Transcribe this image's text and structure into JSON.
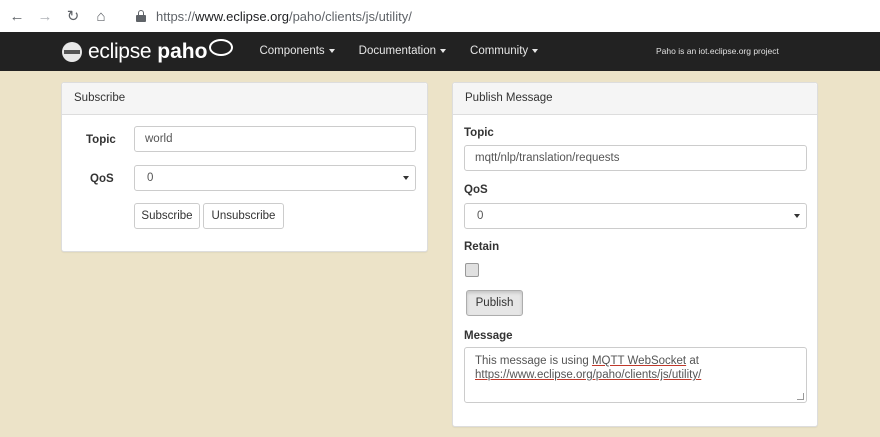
{
  "browser": {
    "url_scheme": "https://",
    "url_host": "www.eclipse.org",
    "url_path": "/paho/clients/js/utility/"
  },
  "navbar": {
    "logo_eclipse": "eclipse",
    "logo_paho": "paho",
    "menu": [
      {
        "label": "Components"
      },
      {
        "label": "Documentation"
      },
      {
        "label": "Community"
      }
    ],
    "tagline": "Paho is an iot.eclipse.org project",
    "background": "#222222"
  },
  "subscribe": {
    "heading": "Subscribe",
    "topic_label": "Topic",
    "topic_value": "world",
    "qos_label": "QoS",
    "qos_value": "0",
    "subscribe_button": "Subscribe",
    "unsubscribe_button": "Unsubscribe"
  },
  "publish": {
    "heading": "Publish Message",
    "topic_label": "Topic",
    "topic_value": "mqtt/nlp/translation/requests",
    "qos_label": "QoS",
    "qos_value": "0",
    "retain_label": "Retain",
    "retain_checked": false,
    "publish_button": "Publish",
    "message_label": "Message",
    "message_line1_a": "This message is using ",
    "message_line1_b": "MQTT WebSocket",
    "message_line1_c": " at",
    "message_line2": "https://www.eclipse.org/paho/clients/js/utility/"
  },
  "colors": {
    "page_background": "#ece3c8",
    "panel_heading": "#f5f5f5"
  }
}
